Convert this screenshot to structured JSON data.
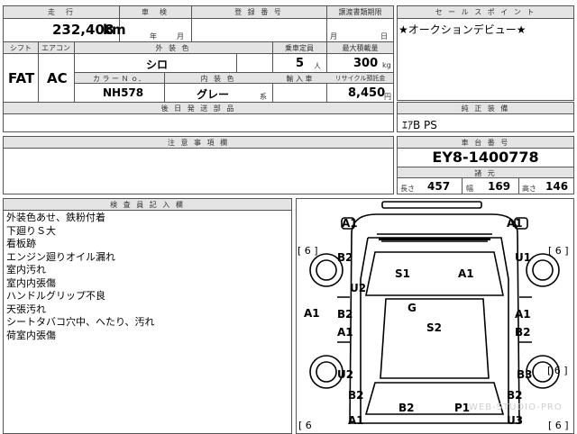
{
  "top": {
    "mileage_header": "走　行",
    "inspection_header": "車　検",
    "registration_header": "登 録 番 号",
    "transfer_header": "譲渡書類期限",
    "mileage_value": "232,408",
    "mileage_unit": "km",
    "year_unit": "年",
    "month_unit": "月",
    "transfer_month_unit": "月",
    "transfer_day_unit": "日"
  },
  "sales_point": {
    "header": "セ ー ル ス ポ イ ン ト",
    "text": "★オークションデビュー★"
  },
  "vehicle": {
    "shift_header": "シフト",
    "aircon_header": "エアコン",
    "exterior_color_header": "外 装 色",
    "capacity_header": "乗車定員",
    "max_load_header": "最大積載量",
    "shift_value": "FAT",
    "aircon_value": "AC",
    "exterior_color_value": "シロ",
    "capacity_value": "5",
    "capacity_unit": "人",
    "max_load_value": "300",
    "max_load_unit": "kg",
    "color_no_header": "カ ラ ー Ｎ ｏ．",
    "interior_color_header": "内 装 色",
    "import_header": "輸 入 車",
    "recycle_header": "リサイクル預託金",
    "color_no_value": "NH578",
    "interior_color_value": "グレー",
    "interior_color_suffix": "系",
    "recycle_value": "8,450",
    "recycle_unit": "円",
    "later_parts_header": "後 日 発 送 部 品"
  },
  "equipment": {
    "header": "純 正 装 備",
    "text": "ｴｱB PS"
  },
  "caution": {
    "header": "注 意 事 項 欄"
  },
  "chassis": {
    "header": "車 台 番 号",
    "value": "EY8-1400778",
    "dims_header": "諸 元",
    "length_label": "長さ",
    "length_value": "457",
    "width_label": "幅",
    "width_value": "169",
    "height_label": "高さ",
    "height_value": "146"
  },
  "inspector": {
    "header": "検 査 員 記 入 欄",
    "notes": [
      "外装色あせ、鉄粉付着",
      "下廻りＳ大",
      "看板跡",
      "エンジン廻りオイル漏れ",
      "室内汚れ",
      "室内内張傷",
      "ハンドルグリップ不良",
      "天張汚れ",
      "シートタバコ穴中、へたり、汚れ",
      "荷室内張傷"
    ]
  },
  "diagram": {
    "labels": {
      "front_left": "A1",
      "front_right": "A1",
      "bracket_fl": "[ 6 ]",
      "bracket_fr": "[ 6 ]",
      "fender_left": "B2",
      "fender_right": "U1",
      "windshield_s": "S1",
      "windshield_a": "A1",
      "door_front_left": "U2",
      "left_edge": "A1",
      "roof": "G",
      "door_left_b": "B2",
      "door_right_a": "A1",
      "door_left_a": "A1",
      "door_right_b": "B2",
      "roof_s": "S2",
      "rear_door_left": "U2",
      "rear_door_right": "B3",
      "right_edge_bracket": "[ 6 ]",
      "quarter_left": "B2",
      "quarter_right": "B2",
      "rear_left": "A1",
      "rear_b": "B2",
      "rear_p": "P1",
      "rear_u": "U3",
      "bracket_rl": "[ 6",
      "bracket_rr": "[ 6 ]"
    },
    "watermark": "WEB-STUDIO-PRO"
  }
}
